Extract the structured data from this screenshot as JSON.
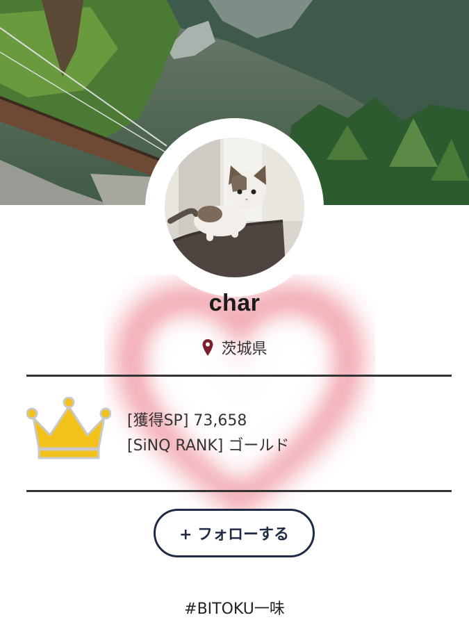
{
  "profile": {
    "username": "char",
    "location": "茨城県"
  },
  "stats": {
    "sp_label": "[獲得SP]",
    "sp_value": "73,658",
    "rank_label": "[SiNQ RANK]",
    "rank_value": "ゴールド"
  },
  "actions": {
    "follow_label": "+ フォローする"
  },
  "tagline": "#BITOKU一味",
  "icons": {
    "location": "map-pin-icon",
    "rank": "crown-icon"
  },
  "colors": {
    "crown_fill": "#f2c21b",
    "crown_outline": "#c9c9c9",
    "pin": "#7a1f2b",
    "button_border": "#1f2a44",
    "heart_glow": "#e0344a"
  }
}
